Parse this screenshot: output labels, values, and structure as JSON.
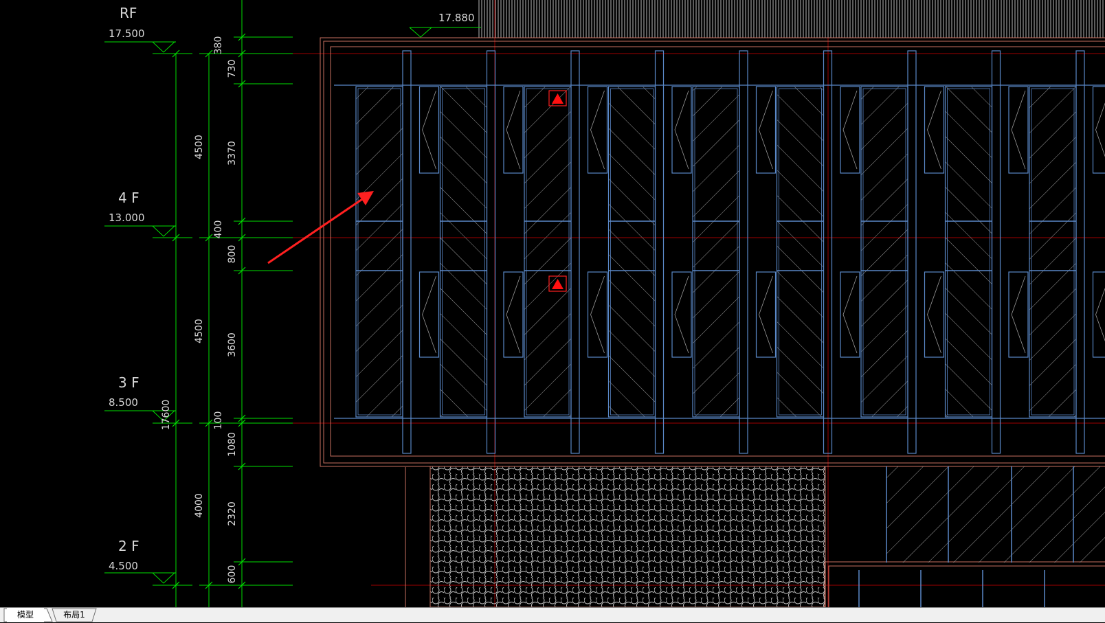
{
  "levels": [
    {
      "name": "RF",
      "elevation": "17.500"
    },
    {
      "name": "4 F",
      "elevation": "13.000"
    },
    {
      "name": "3 F",
      "elevation": "8.500"
    },
    {
      "name": "2 F",
      "elevation": "4.500"
    }
  ],
  "parapet_elevation": "17.880",
  "dims_floor": [
    "4500",
    "4500",
    "4000"
  ],
  "dims_overall": "17600",
  "dims_detail": [
    "380",
    "730",
    "3370",
    "400",
    "800",
    "3600",
    "100",
    "1080",
    "2320",
    "600"
  ],
  "tabs": [
    {
      "label": "模型",
      "active": true
    },
    {
      "label": "布局1",
      "active": false
    }
  ],
  "colors": {
    "background": "#000000",
    "dimension_lines": "#00ff00",
    "glazing": "#5a88c8",
    "outline": "#c87060",
    "axis": "#b00000",
    "hatch": "#aaaaaa",
    "annotation_arrow": "#ff2020",
    "marker": "#ff0000"
  }
}
